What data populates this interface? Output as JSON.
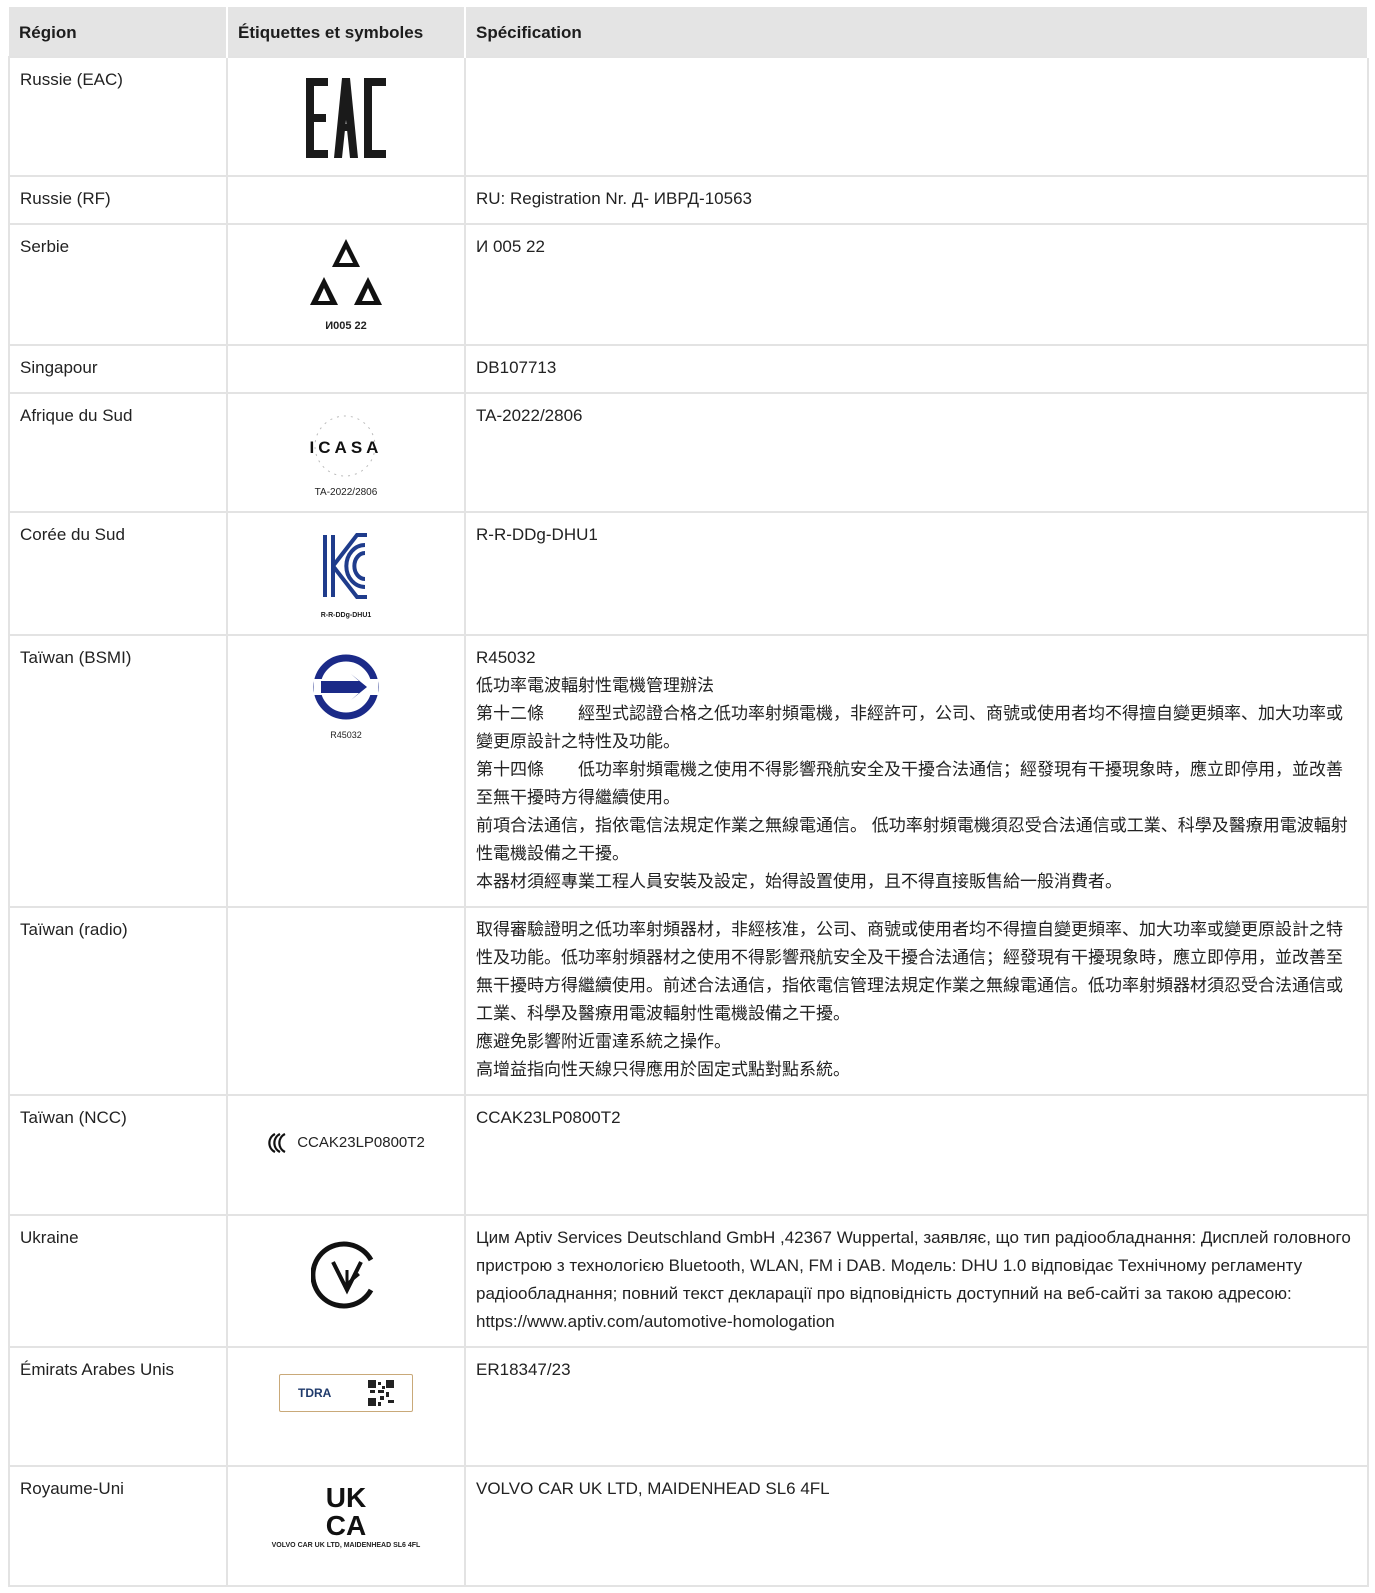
{
  "headers": {
    "region": "Région",
    "symbols": "Étiquettes et symboles",
    "spec": "Spécification"
  },
  "rows": [
    {
      "region": "Russie (EAC)",
      "symbol": "eac-logo",
      "logo_text": "",
      "spec": []
    },
    {
      "region": "Russie (RF)",
      "symbol": "",
      "logo_text": "",
      "spec": [
        "RU: Registration Nr. Д- ИВРД-10563"
      ]
    },
    {
      "region": "Serbie",
      "symbol": "serbia-triangles-logo",
      "logo_text": "И005 22",
      "spec": [
        "И 005 22"
      ]
    },
    {
      "region": "Singapour",
      "symbol": "",
      "logo_text": "",
      "spec": [
        "DB107713"
      ]
    },
    {
      "region": "Afrique du Sud",
      "symbol": "icasa-logo",
      "logo_text": "TA-2022/2806",
      "spec": [
        "TA-2022/2806"
      ]
    },
    {
      "region": "Corée du Sud",
      "symbol": "kc-logo",
      "logo_text": "R-R-DDg-DHU1",
      "spec": [
        "R-R-DDg-DHU1"
      ]
    },
    {
      "region": "Taïwan (BSMI)",
      "symbol": "bsmi-logo",
      "logo_text": "R45032",
      "spec": [
        "R45032",
        "低功率電波輻射性電機管理辦法",
        "第十二條　　經型式認證合格之低功率射頻電機，非經許可，公司、商號或使用者均不得擅自變更頻率、加大功率或變更原設計之特性及功能。",
        "第十四條　　低功率射頻電機之使用不得影響飛航安全及干擾合法通信；經發現有干擾現象時，應立即停用，並改善至無干擾時方得繼續使用。",
        "前項合法通信，指依電信法規定作業之無線電通信。 低功率射頻電機須忍受合法通信或工業、科學及醫療用電波輻射性電機設備之干擾。",
        "本器材須經專業工程人員安裝及設定，始得設置使用，且不得直接販售給一般消費者。"
      ]
    },
    {
      "region": "Taïwan (radio)",
      "symbol": "",
      "logo_text": "",
      "spec": [
        "取得審驗證明之低功率射頻器材，非經核准，公司、商號或使用者均不得擅自變更頻率、加大功率或變更原設計之特性及功能。低功率射頻器材之使用不得影響飛航安全及干擾合法通信；經發現有干擾現象時，應立即停用，並改善至無干擾時方得繼續使用。前述合法通信，指依電信管理法規定作業之無線電通信。低功率射頻器材須忍受合法通信或工業、科學及醫療用電波輻射性電機設備之干擾。",
        "應避免影響附近雷達系統之操作。",
        "高增益指向性天線只得應用於固定式點對點系統。"
      ]
    },
    {
      "region": "Taïwan (NCC)",
      "symbol": "ncc-logo",
      "logo_text": "CCAK23LP0800T2",
      "spec": [
        "CCAK23LP0800T2"
      ]
    },
    {
      "region": "Ukraine",
      "symbol": "ukraine-conformity-logo",
      "logo_text": "",
      "spec": [
        "Цим Aptiv Services Deutschland GmbH ,42367 Wuppertal, заявляє, що тип радіообладнання: Дисплей головного пристрою з технологією Bluetooth, WLAN, FM і DAB. Модель: DHU 1.0 відповідає Технічному регламенту радіообладнання; повний текст декларації про відповідність доступний на веб-сайті за такою адресою: https://www.aptiv.com/automotive-homologation"
      ]
    },
    {
      "region": "Émirats Arabes Unis",
      "symbol": "tdra-logo",
      "logo_text": "TDRA",
      "spec": [
        "ER18347/23"
      ]
    },
    {
      "region": "Royaume-Uni",
      "symbol": "ukca-logo",
      "logo_text": "VOLVO CAR UK LTD, MAIDENHEAD SL6 4FL",
      "spec": [
        "VOLVO CAR UK LTD, MAIDENHEAD SL6 4FL"
      ]
    }
  ]
}
